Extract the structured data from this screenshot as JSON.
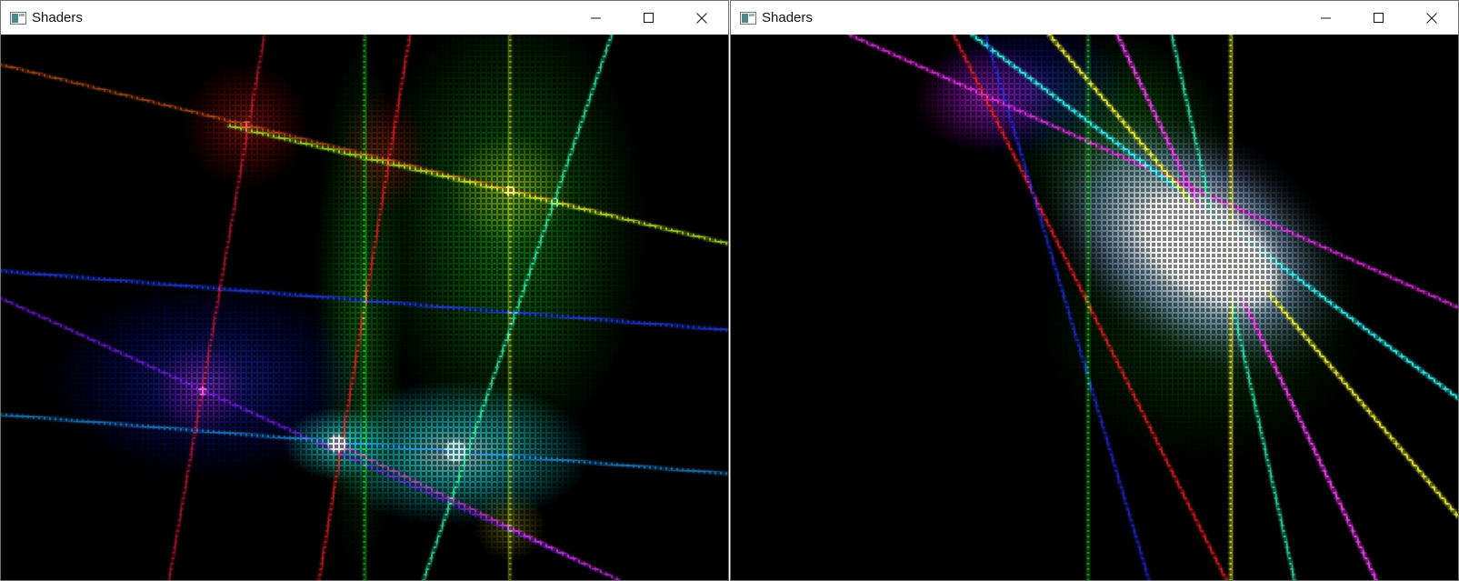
{
  "windows": [
    {
      "id": "left",
      "title": "Shaders",
      "controls": [
        "minimize-icon",
        "maximize-icon",
        "close-icon"
      ]
    },
    {
      "id": "right",
      "title": "Shaders",
      "controls": [
        "minimize-icon",
        "maximize-icon",
        "close-icon"
      ]
    }
  ],
  "colors": {
    "titlebar": "#ffffff",
    "canvas": "#000000",
    "border": "#707070",
    "red": "#ff2020",
    "green": "#20ff20",
    "blue": "#2030ff",
    "yellow": "#ffff30",
    "cyan": "#30ffff",
    "magenta": "#ff30ff"
  }
}
